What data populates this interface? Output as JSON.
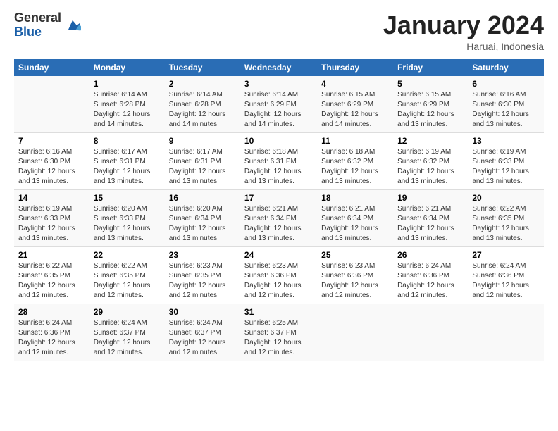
{
  "logo": {
    "general": "General",
    "blue": "Blue"
  },
  "title": "January 2024",
  "location": "Haruai, Indonesia",
  "days_header": [
    "Sunday",
    "Monday",
    "Tuesday",
    "Wednesday",
    "Thursday",
    "Friday",
    "Saturday"
  ],
  "weeks": [
    [
      {
        "day": "",
        "info": ""
      },
      {
        "day": "1",
        "info": "Sunrise: 6:14 AM\nSunset: 6:28 PM\nDaylight: 12 hours\nand 14 minutes."
      },
      {
        "day": "2",
        "info": "Sunrise: 6:14 AM\nSunset: 6:28 PM\nDaylight: 12 hours\nand 14 minutes."
      },
      {
        "day": "3",
        "info": "Sunrise: 6:14 AM\nSunset: 6:29 PM\nDaylight: 12 hours\nand 14 minutes."
      },
      {
        "day": "4",
        "info": "Sunrise: 6:15 AM\nSunset: 6:29 PM\nDaylight: 12 hours\nand 14 minutes."
      },
      {
        "day": "5",
        "info": "Sunrise: 6:15 AM\nSunset: 6:29 PM\nDaylight: 12 hours\nand 13 minutes."
      },
      {
        "day": "6",
        "info": "Sunrise: 6:16 AM\nSunset: 6:30 PM\nDaylight: 12 hours\nand 13 minutes."
      }
    ],
    [
      {
        "day": "7",
        "info": "Sunrise: 6:16 AM\nSunset: 6:30 PM\nDaylight: 12 hours\nand 13 minutes."
      },
      {
        "day": "8",
        "info": "Sunrise: 6:17 AM\nSunset: 6:31 PM\nDaylight: 12 hours\nand 13 minutes."
      },
      {
        "day": "9",
        "info": "Sunrise: 6:17 AM\nSunset: 6:31 PM\nDaylight: 12 hours\nand 13 minutes."
      },
      {
        "day": "10",
        "info": "Sunrise: 6:18 AM\nSunset: 6:31 PM\nDaylight: 12 hours\nand 13 minutes."
      },
      {
        "day": "11",
        "info": "Sunrise: 6:18 AM\nSunset: 6:32 PM\nDaylight: 12 hours\nand 13 minutes."
      },
      {
        "day": "12",
        "info": "Sunrise: 6:19 AM\nSunset: 6:32 PM\nDaylight: 12 hours\nand 13 minutes."
      },
      {
        "day": "13",
        "info": "Sunrise: 6:19 AM\nSunset: 6:33 PM\nDaylight: 12 hours\nand 13 minutes."
      }
    ],
    [
      {
        "day": "14",
        "info": "Sunrise: 6:19 AM\nSunset: 6:33 PM\nDaylight: 12 hours\nand 13 minutes."
      },
      {
        "day": "15",
        "info": "Sunrise: 6:20 AM\nSunset: 6:33 PM\nDaylight: 12 hours\nand 13 minutes."
      },
      {
        "day": "16",
        "info": "Sunrise: 6:20 AM\nSunset: 6:34 PM\nDaylight: 12 hours\nand 13 minutes."
      },
      {
        "day": "17",
        "info": "Sunrise: 6:21 AM\nSunset: 6:34 PM\nDaylight: 12 hours\nand 13 minutes."
      },
      {
        "day": "18",
        "info": "Sunrise: 6:21 AM\nSunset: 6:34 PM\nDaylight: 12 hours\nand 13 minutes."
      },
      {
        "day": "19",
        "info": "Sunrise: 6:21 AM\nSunset: 6:34 PM\nDaylight: 12 hours\nand 13 minutes."
      },
      {
        "day": "20",
        "info": "Sunrise: 6:22 AM\nSunset: 6:35 PM\nDaylight: 12 hours\nand 13 minutes."
      }
    ],
    [
      {
        "day": "21",
        "info": "Sunrise: 6:22 AM\nSunset: 6:35 PM\nDaylight: 12 hours\nand 12 minutes."
      },
      {
        "day": "22",
        "info": "Sunrise: 6:22 AM\nSunset: 6:35 PM\nDaylight: 12 hours\nand 12 minutes."
      },
      {
        "day": "23",
        "info": "Sunrise: 6:23 AM\nSunset: 6:35 PM\nDaylight: 12 hours\nand 12 minutes."
      },
      {
        "day": "24",
        "info": "Sunrise: 6:23 AM\nSunset: 6:36 PM\nDaylight: 12 hours\nand 12 minutes."
      },
      {
        "day": "25",
        "info": "Sunrise: 6:23 AM\nSunset: 6:36 PM\nDaylight: 12 hours\nand 12 minutes."
      },
      {
        "day": "26",
        "info": "Sunrise: 6:24 AM\nSunset: 6:36 PM\nDaylight: 12 hours\nand 12 minutes."
      },
      {
        "day": "27",
        "info": "Sunrise: 6:24 AM\nSunset: 6:36 PM\nDaylight: 12 hours\nand 12 minutes."
      }
    ],
    [
      {
        "day": "28",
        "info": "Sunrise: 6:24 AM\nSunset: 6:36 PM\nDaylight: 12 hours\nand 12 minutes."
      },
      {
        "day": "29",
        "info": "Sunrise: 6:24 AM\nSunset: 6:37 PM\nDaylight: 12 hours\nand 12 minutes."
      },
      {
        "day": "30",
        "info": "Sunrise: 6:24 AM\nSunset: 6:37 PM\nDaylight: 12 hours\nand 12 minutes."
      },
      {
        "day": "31",
        "info": "Sunrise: 6:25 AM\nSunset: 6:37 PM\nDaylight: 12 hours\nand 12 minutes."
      },
      {
        "day": "",
        "info": ""
      },
      {
        "day": "",
        "info": ""
      },
      {
        "day": "",
        "info": ""
      }
    ]
  ]
}
